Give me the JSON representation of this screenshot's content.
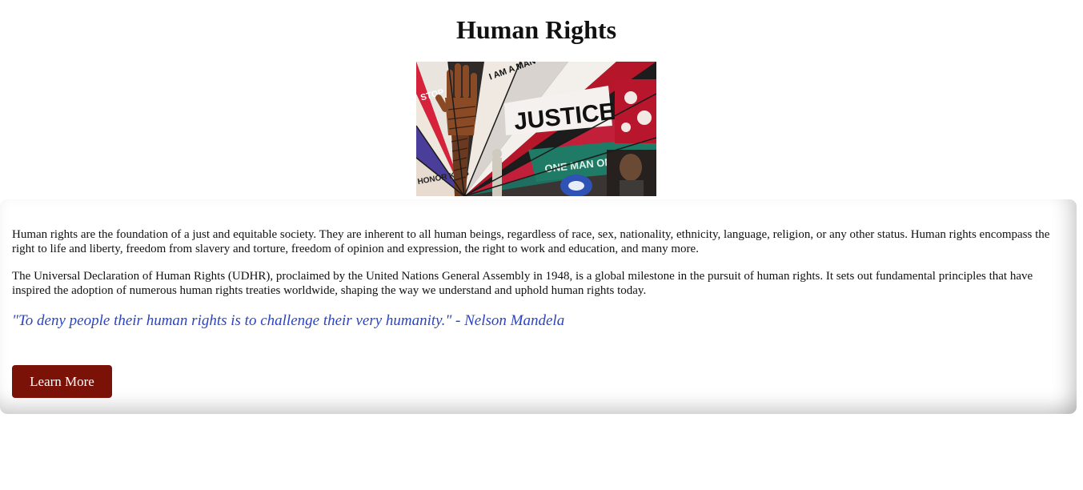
{
  "page": {
    "title": "Human Rights"
  },
  "hero": {
    "image_name": "human-rights-collage-image",
    "artwork_text": [
      "I AM A MAN",
      "JUSTICE",
      "ONE MAN ONE VOTE",
      "STOP",
      "HONOR KING"
    ]
  },
  "content": {
    "paragraph_1": "Human rights are the foundation of a just and equitable society. They are inherent to all human beings, regardless of race, sex, nationality, ethnicity, language, religion, or any other status. Human rights encompass the right to life and liberty, freedom from slavery and torture, freedom of opinion and expression, the right to work and education, and many more.",
    "paragraph_2": "The Universal Declaration of Human Rights (UDHR), proclaimed by the United Nations General Assembly in 1948, is a global milestone in the pursuit of human rights. It sets out fundamental principles that have inspired the adoption of numerous human rights treaties worldwide, shaping the way we understand and uphold human rights today.",
    "quote": "\"To deny people their human rights is to challenge their very humanity.\" - Nelson Mandela"
  },
  "actions": {
    "learn_more_label": "Learn More"
  },
  "colors": {
    "quote": "#2a44c4",
    "button_bg": "#7a1208",
    "button_text": "#ffffff"
  }
}
